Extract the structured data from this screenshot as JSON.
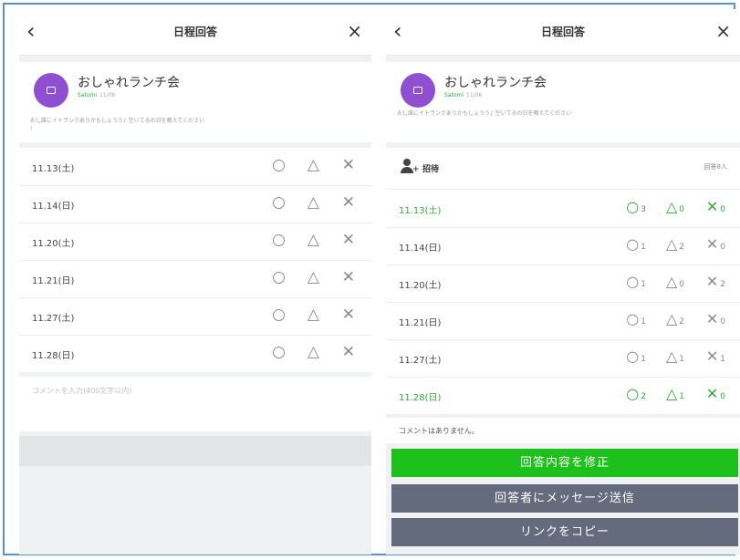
{
  "left": {
    "nav": {
      "title": "日程回答",
      "back_glyph": "‹",
      "close_glyph": "×"
    },
    "group": {
      "name": "おしゃれランチ会",
      "author": "Satomi",
      "time": "11/06",
      "description_prefix": "おし誰にイトランクありかもしょうう♪",
      "description_highlight": "♪",
      "description_suffix": "空いてるの日を教えてください",
      "description_tail": "!"
    },
    "rows": [
      {
        "date": "11.13(土)"
      },
      {
        "date": "11.14(日)"
      },
      {
        "date": "11.20(土)"
      },
      {
        "date": "11.21(日)"
      },
      {
        "date": "11.27(土)"
      },
      {
        "date": "11.28(日)"
      }
    ],
    "symbols": {
      "yes": "○",
      "maybe": "△",
      "no": "✕"
    },
    "comment_placeholder": "コメントを入力(400文字以内)"
  },
  "right": {
    "nav": {
      "title": "日程回答",
      "back_glyph": "‹",
      "close_glyph": "×"
    },
    "group": {
      "name": "おしゃれランチ会",
      "author": "Satomi",
      "time": "11/06",
      "description": "おし誰にイトランクありかもしょうう♪ 空いてるの日を教えてください"
    },
    "invite": {
      "label": "招待",
      "count": "回答8人"
    },
    "rows": [
      {
        "date": "11.13(土)",
        "yes": "3",
        "maybe": "0",
        "no": "0",
        "highlight": true
      },
      {
        "date": "11.14(日)",
        "yes": "1",
        "maybe": "2",
        "no": "0",
        "highlight": false
      },
      {
        "date": "11.20(土)",
        "yes": "1",
        "maybe": "0",
        "no": "2",
        "highlight": false
      },
      {
        "date": "11.21(日)",
        "yes": "1",
        "maybe": "2",
        "no": "0",
        "highlight": false
      },
      {
        "date": "11.27(土)",
        "yes": "1",
        "maybe": "1",
        "no": "1",
        "highlight": false
      },
      {
        "date": "11.28(日)",
        "yes": "2",
        "maybe": "1",
        "no": "0",
        "highlight": true
      }
    ],
    "no_comment": "コメントはありません。",
    "buttons": {
      "edit": "回答内容を修正",
      "message": "回答者にメッセージ送信",
      "copy": "リンクをコピー"
    }
  },
  "colors": {
    "accent_green": "#1cc11c",
    "avatar_purple": "#8e4fd0",
    "button_gray": "#636b7c",
    "highlight_text": "#2eac3c",
    "frame_blue": "#5b8fd6"
  },
  "icons": {
    "back": "chevron-left-icon",
    "close": "close-icon",
    "avatar": "chat-bubble-icon",
    "invite": "person-add-icon"
  }
}
